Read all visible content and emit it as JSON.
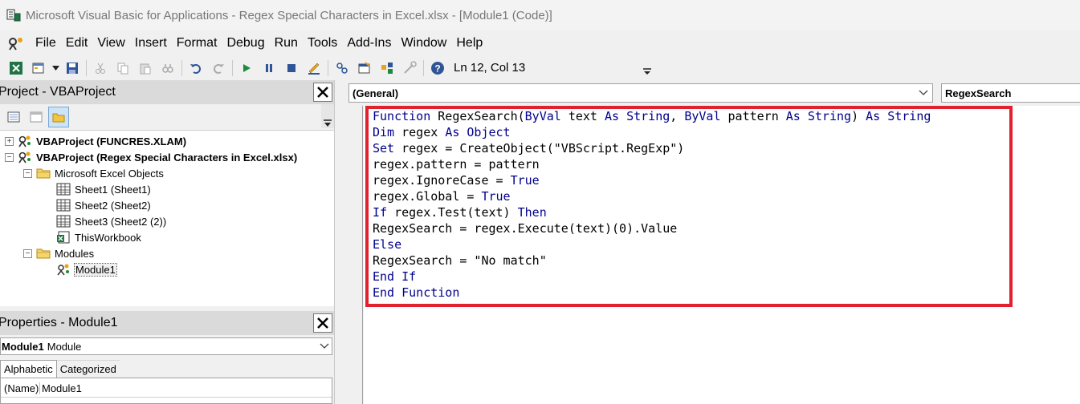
{
  "window": {
    "title": "Microsoft Visual Basic for Applications - Regex Special Characters in Excel.xlsx - [Module1 (Code)]"
  },
  "menu": {
    "items": [
      "File",
      "Edit",
      "View",
      "Insert",
      "Format",
      "Debug",
      "Run",
      "Tools",
      "Add-Ins",
      "Window",
      "Help"
    ]
  },
  "toolbar": {
    "status": "Ln 12, Col 13",
    "icons": [
      "excel-icon",
      "insert-module-icon",
      "save-icon",
      "cut-icon",
      "copy-icon",
      "paste-icon",
      "find-icon",
      "undo-icon",
      "redo-icon",
      "run-icon",
      "break-icon",
      "reset-icon",
      "design-mode-icon",
      "project-explorer-icon",
      "properties-icon",
      "object-browser-icon",
      "toolbox-icon",
      "help-icon"
    ]
  },
  "project": {
    "header": "Project - VBAProject",
    "tree": [
      {
        "label": "VBAProject (FUNCRES.XLAM)"
      },
      {
        "label": "VBAProject (Regex Special Characters in Excel.xlsx)"
      },
      {
        "label": "Microsoft Excel Objects"
      },
      {
        "label": "Sheet1 (Sheet1)"
      },
      {
        "label": "Sheet2 (Sheet2)"
      },
      {
        "label": "Sheet3 (Sheet2 (2))"
      },
      {
        "label": "ThisWorkbook"
      },
      {
        "label": "Modules"
      },
      {
        "label": "Module1"
      }
    ]
  },
  "properties": {
    "header": "Properties - Module1",
    "object_name": "Module1",
    "object_type": "Module",
    "tabs": [
      "Alphabetic",
      "Categorized"
    ],
    "rows": [
      {
        "name": "(Name)",
        "value": "Module1"
      }
    ]
  },
  "code": {
    "object_combo": "(General)",
    "proc_combo": "RegexSearch",
    "highlight_color": "#e0212f",
    "keyword_color": "#00008b",
    "lines": [
      [
        {
          "t": "Function",
          "k": true
        },
        {
          "t": " RegexSearch("
        },
        {
          "t": "ByVal",
          "k": true
        },
        {
          "t": " text "
        },
        {
          "t": "As",
          "k": true
        },
        {
          "t": " "
        },
        {
          "t": "String",
          "k": true
        },
        {
          "t": ", "
        },
        {
          "t": "ByVal",
          "k": true
        },
        {
          "t": " pattern "
        },
        {
          "t": "As",
          "k": true
        },
        {
          "t": " "
        },
        {
          "t": "String",
          "k": true
        },
        {
          "t": ") "
        },
        {
          "t": "As",
          "k": true
        },
        {
          "t": " "
        },
        {
          "t": "String",
          "k": true
        }
      ],
      [
        {
          "t": "Dim",
          "k": true
        },
        {
          "t": " regex "
        },
        {
          "t": "As",
          "k": true
        },
        {
          "t": " "
        },
        {
          "t": "Object",
          "k": true
        }
      ],
      [
        {
          "t": "Set",
          "k": true
        },
        {
          "t": " regex = CreateObject(\"VBScript.RegExp\")"
        }
      ],
      [
        {
          "t": "regex.pattern = pattern"
        }
      ],
      [
        {
          "t": "regex.IgnoreCase = "
        },
        {
          "t": "True",
          "k": true
        }
      ],
      [
        {
          "t": "regex.Global = "
        },
        {
          "t": "True",
          "k": true
        }
      ],
      [
        {
          "t": "If",
          "k": true
        },
        {
          "t": " regex.Test(text) "
        },
        {
          "t": "Then",
          "k": true
        }
      ],
      [
        {
          "t": "RegexSearch = regex.Execute(text)(0).Value"
        }
      ],
      [
        {
          "t": "Else",
          "k": true
        }
      ],
      [
        {
          "t": "RegexSearch = \"No match\""
        }
      ],
      [
        {
          "t": "End If",
          "k": true
        }
      ],
      [
        {
          "t": "End Function",
          "k": true
        }
      ]
    ]
  }
}
